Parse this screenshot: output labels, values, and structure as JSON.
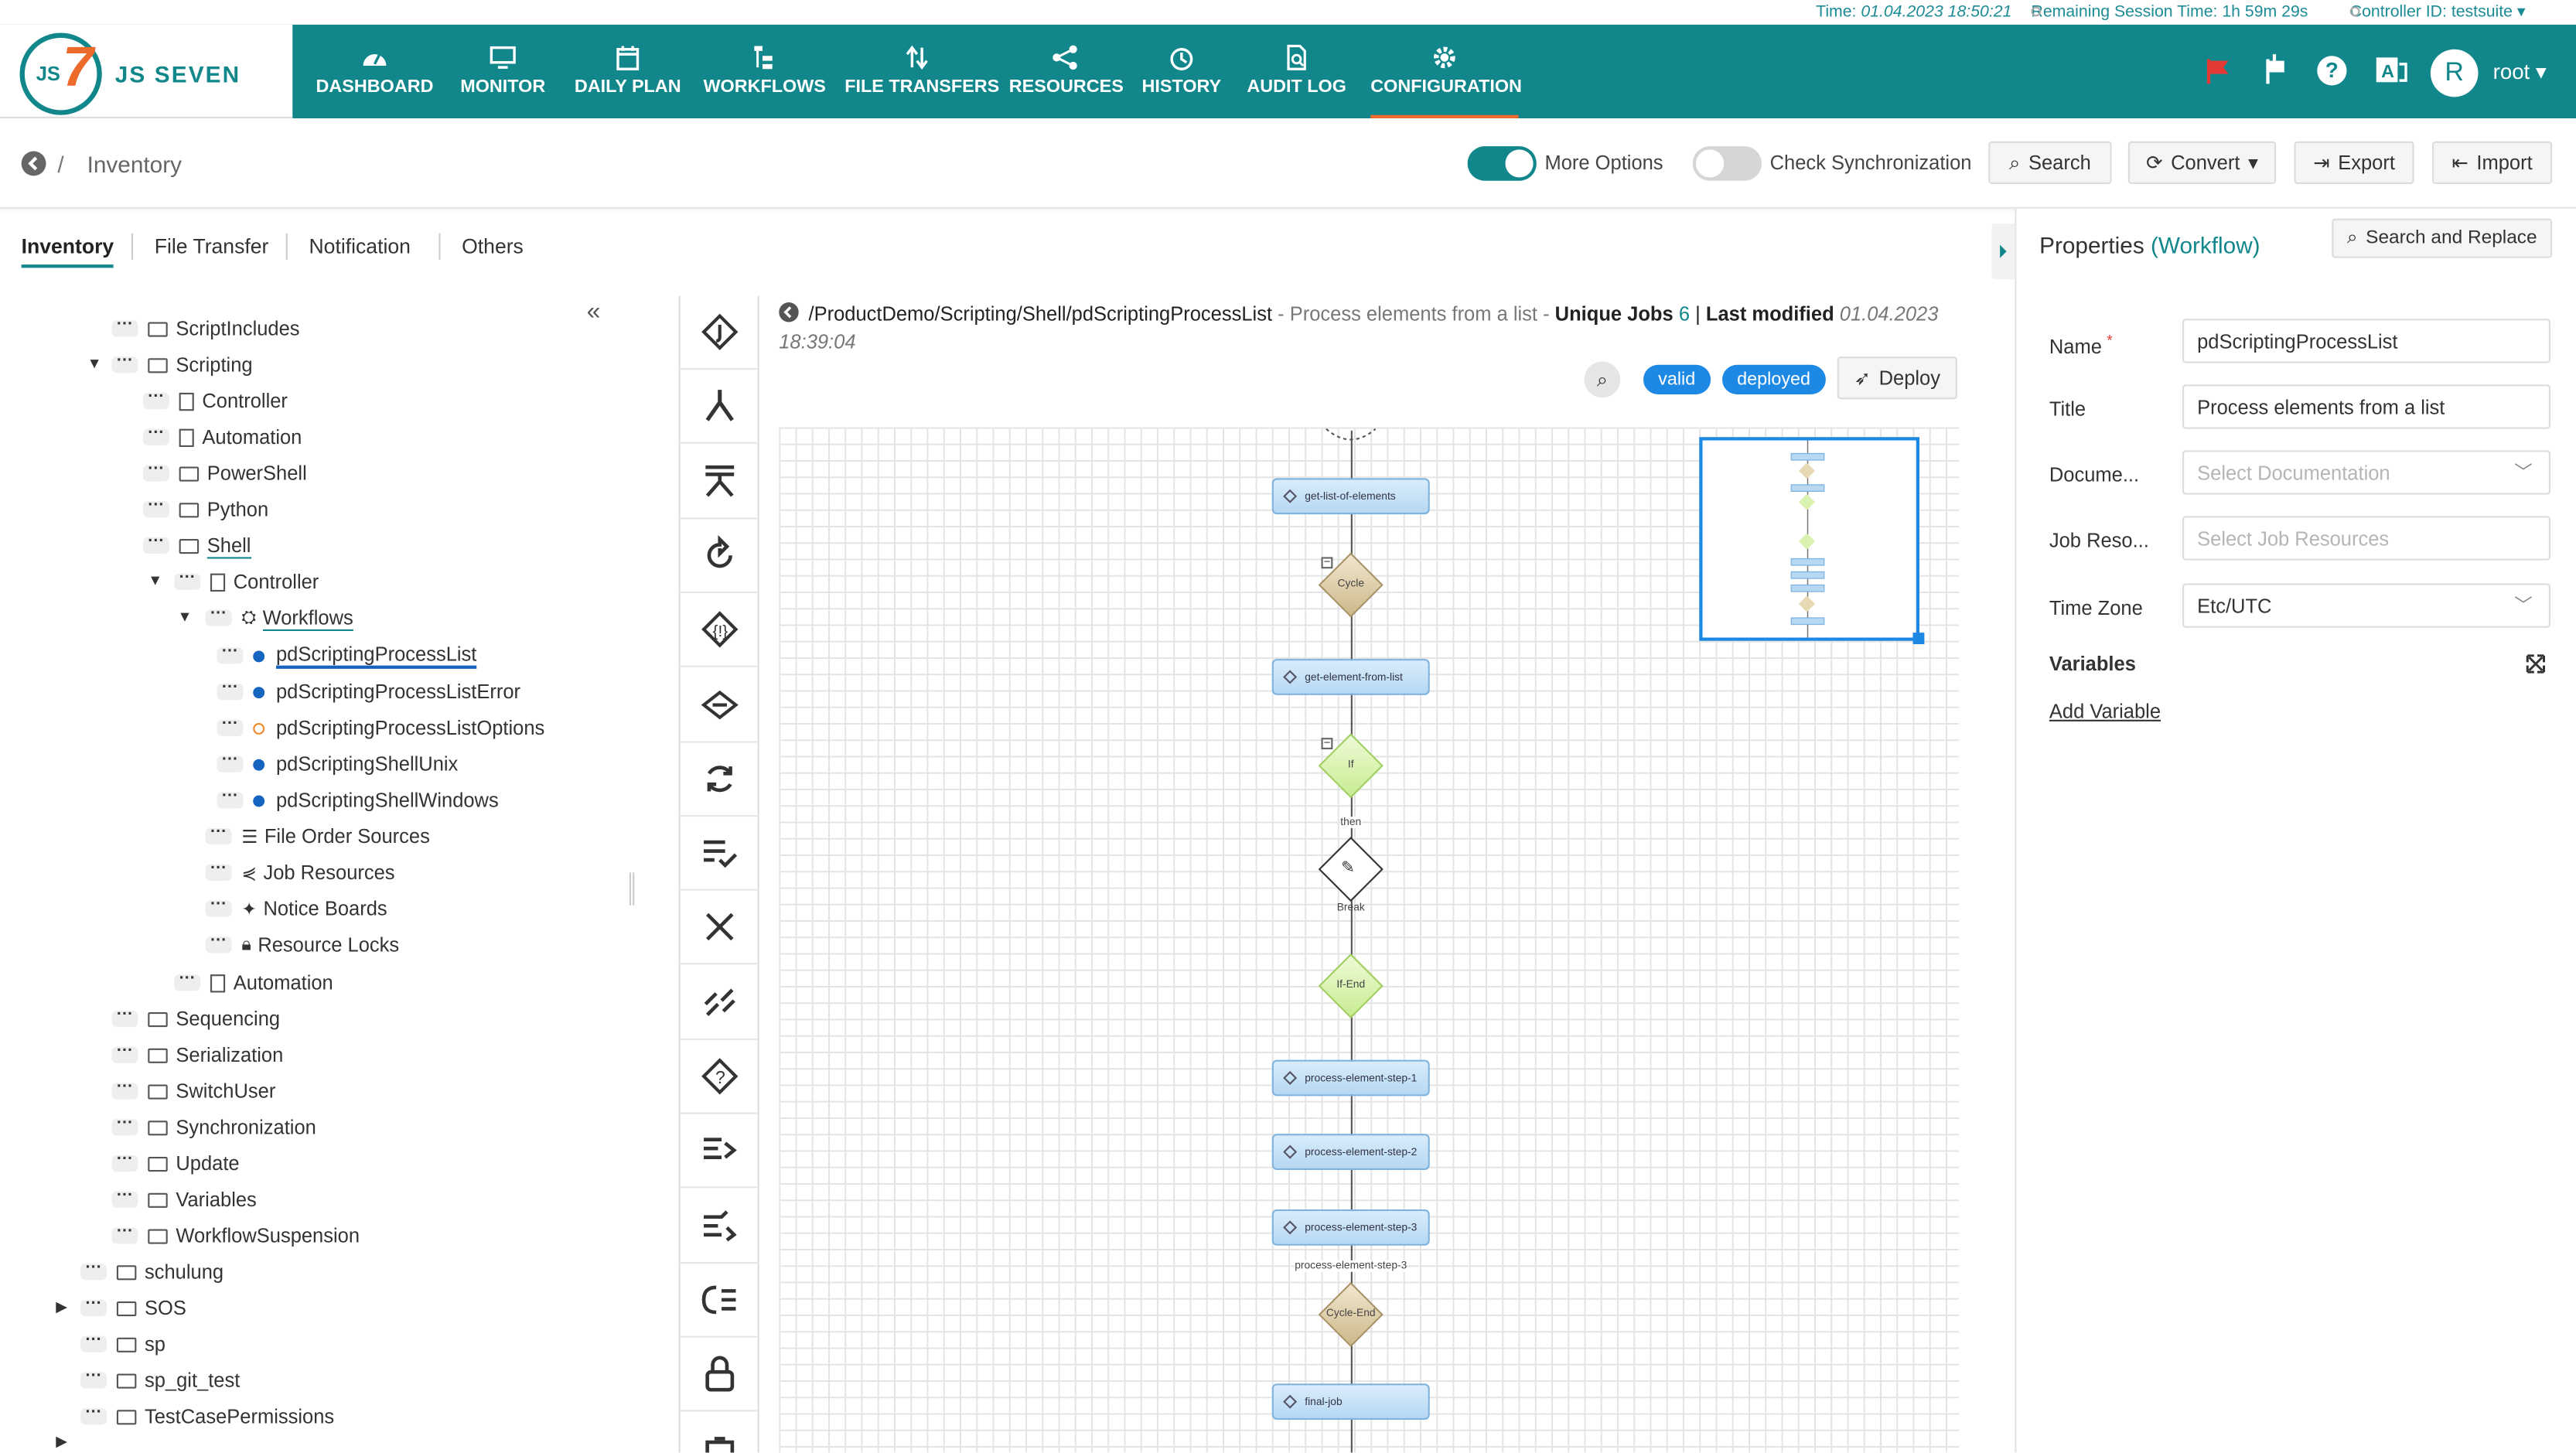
{
  "infobar": {
    "time_label": "Time:",
    "time_value": "01.04.2023 18:50:21",
    "session_label": "Remaining Session Time:",
    "session_value": "1h 59m 29s",
    "controller_label": "Controller ID:",
    "controller_value": "testsuite"
  },
  "brand": {
    "name": "JS SEVEN",
    "js": "JS",
    "seven": "7"
  },
  "nav": [
    {
      "label": "DASHBOARD",
      "icon": "dashboard-icon"
    },
    {
      "label": "MONITOR",
      "icon": "monitor-icon"
    },
    {
      "label": "DAILY PLAN",
      "icon": "calendar-icon"
    },
    {
      "label": "WORKFLOWS",
      "icon": "workflows-icon"
    },
    {
      "label": "FILE TRANSFERS",
      "icon": "file-transfer-icon"
    },
    {
      "label": "RESOURCES",
      "icon": "share-icon"
    },
    {
      "label": "HISTORY",
      "icon": "clock-icon"
    },
    {
      "label": "AUDIT LOG",
      "icon": "audit-search-icon"
    },
    {
      "label": "CONFIGURATION",
      "icon": "gear-icon",
      "active": true
    }
  ],
  "user": {
    "avatar": "R",
    "name": "root"
  },
  "breadcrumb": {
    "sep": "/",
    "title": "Inventory"
  },
  "toolbar": {
    "more_options": "More Options",
    "check_sync": "Check Synchronization",
    "search": "Search",
    "convert": "Convert",
    "export": "Export",
    "import": "Import"
  },
  "left_tabs": [
    "Inventory",
    "File Transfer",
    "Notification",
    "Others"
  ],
  "tree": [
    {
      "label": "ScriptIncludes",
      "type": "folder"
    },
    {
      "label": "Scripting",
      "type": "folder-open"
    },
    {
      "label": "Controller",
      "type": "doc"
    },
    {
      "label": "Automation",
      "type": "doc"
    },
    {
      "label": "PowerShell",
      "type": "folder"
    },
    {
      "label": "Python",
      "type": "folder"
    },
    {
      "label": "Shell",
      "type": "folder-open"
    },
    {
      "label": "Controller",
      "type": "doc"
    },
    {
      "label": "Workflows",
      "type": "workflow"
    },
    {
      "label": "pdScriptingProcessList",
      "type": "bullet"
    },
    {
      "label": "pdScriptingProcessListError",
      "type": "bullet"
    },
    {
      "label": "pdScriptingProcessListOptions",
      "type": "bullet-warn"
    },
    {
      "label": "pdScriptingShellUnix",
      "type": "bullet"
    },
    {
      "label": "pdScriptingShellWindows",
      "type": "bullet"
    },
    {
      "label": "File Order Sources",
      "type": "list"
    },
    {
      "label": "Job Resources",
      "type": "share"
    },
    {
      "label": "Notice Boards",
      "type": "pin"
    },
    {
      "label": "Resource Locks",
      "type": "lock"
    },
    {
      "label": "Automation",
      "type": "doc"
    },
    {
      "label": "Sequencing",
      "type": "folder"
    },
    {
      "label": "Serialization",
      "type": "folder"
    },
    {
      "label": "SwitchUser",
      "type": "folder"
    },
    {
      "label": "Synchronization",
      "type": "folder"
    },
    {
      "label": "Update",
      "type": "folder"
    },
    {
      "label": "Variables",
      "type": "folder"
    },
    {
      "label": "WorkflowSuspension",
      "type": "folder"
    },
    {
      "label": "schulung",
      "type": "folder"
    },
    {
      "label": "SOS",
      "type": "folder"
    },
    {
      "label": "sp",
      "type": "folder"
    },
    {
      "label": "sp_git_test",
      "type": "folder"
    },
    {
      "label": "TestCasePermissions",
      "type": "folder"
    }
  ],
  "workflow": {
    "path": "/ProductDemo/Scripting/Shell/pdScriptingProcessList",
    "description": "- Process elements from a list -",
    "unique_jobs_label": "Unique Jobs",
    "unique_jobs_count": "6",
    "divider": "|",
    "last_modified_label": "Last modified",
    "last_modified_date": "01.04.2023",
    "last_modified_time": "18:39:04",
    "badge_valid": "valid",
    "badge_deployed": "deployed",
    "deploy": "Deploy"
  },
  "graph": {
    "job1": "get-list-of-elements",
    "cycle": "Cycle",
    "job2": "get-element-from-list",
    "if": "If",
    "then": "then",
    "break": "Break",
    "if_end": "If-End",
    "job3": "process-element-step-1",
    "job4": "process-element-step-2",
    "job5": "process-element-step-3",
    "edge_label": "process-element-step-3",
    "cycle_end": "Cycle-End",
    "job6": "final-job"
  },
  "properties": {
    "title": "Properties",
    "type": "(Workflow)",
    "search_replace": "Search and Replace",
    "name_label": "Name",
    "required": "*",
    "name_value": "pdScriptingProcessList",
    "title_label": "Title",
    "title_value": "Process elements from a list",
    "doc_label": "Docume...",
    "doc_placeholder": "Select Documentation",
    "jobres_label": "Job Reso...",
    "jobres_placeholder": "Select Job Resources",
    "tz_label": "Time Zone",
    "tz_value": "Etc/UTC",
    "variables_label": "Variables",
    "add_variable": "Add Variable"
  },
  "colors": {
    "brand": "#11878c",
    "accent": "#ec6a2a",
    "badge": "#1e88e5"
  }
}
